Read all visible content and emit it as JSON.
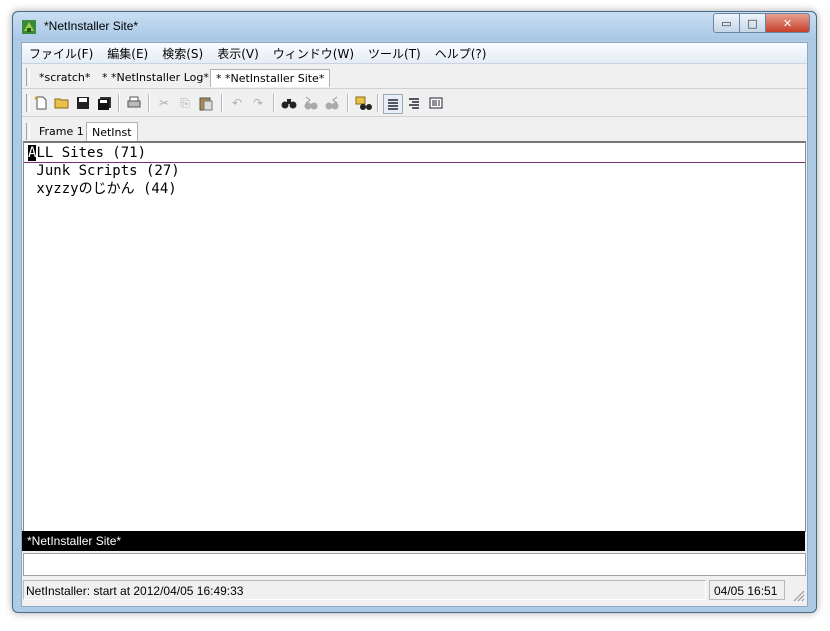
{
  "window": {
    "title": "*NetInstaller Site*",
    "controls": {
      "minimize": "▭",
      "maximize": "□",
      "close": "✕"
    }
  },
  "menu": [
    "ファイル(F)",
    "編集(E)",
    "検索(S)",
    "表示(V)",
    "ウィンドウ(W)",
    "ツール(T)",
    "ヘルプ(?)"
  ],
  "buffer_tabs": [
    "*scratch*",
    "* *NetInstaller Log*",
    "* *NetInstaller Site*"
  ],
  "frame_tabs": [
    "Frame 1",
    "NetInst"
  ],
  "editor": {
    "lines": [
      {
        "cursor_char": "A",
        "rest": "LL Sites (71)"
      },
      {
        "text": " Junk Scripts (27)"
      },
      {
        "text": " xyzzyのじかん (44)"
      }
    ]
  },
  "modeline": "*NetInstaller Site*",
  "status": {
    "message": "NetInstaller: start at 2012/04/05 16:49:33",
    "clock": "04/05 16:51"
  },
  "icons": [
    "new-file-icon",
    "open-folder-icon",
    "save-icon",
    "save-all-icon",
    "print-icon",
    "cut-icon",
    "copy-icon",
    "paste-icon",
    "undo-icon",
    "redo-icon",
    "find-icon",
    "find-next-icon",
    "find-prev-icon",
    "grep-icon",
    "align-left-icon",
    "align-right-icon",
    "columns-icon"
  ]
}
